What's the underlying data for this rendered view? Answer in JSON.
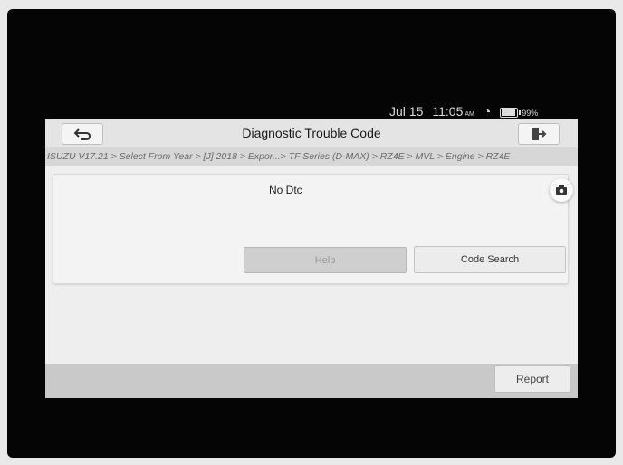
{
  "status": {
    "date": "Jul 15",
    "time": "11:05",
    "ampm": "AM",
    "battery": "99%",
    "wifi_icon": "wifi-icon",
    "battery_icon": "battery-icon"
  },
  "header": {
    "title": "Diagnostic Trouble Code",
    "back_icon": "back-arrow-icon",
    "exit_icon": "exit-icon"
  },
  "breadcrumb": "ISUZU V17.21 > Select From Year > [J] 2018 > Expor...> TF Series (D-MAX) > RZ4E > MVL > Engine > RZ4E",
  "result": {
    "message": "No Dtc",
    "camera_icon": "camera-icon"
  },
  "buttons": {
    "help": "Help",
    "code_search": "Code Search",
    "report": "Report"
  },
  "colors": {
    "screen_bg": "#eeeeee",
    "titlebar_bg": "#e4e4e4",
    "breadcrumb_bg": "#d7d7d7",
    "footer_bg": "#c9c9c9"
  }
}
